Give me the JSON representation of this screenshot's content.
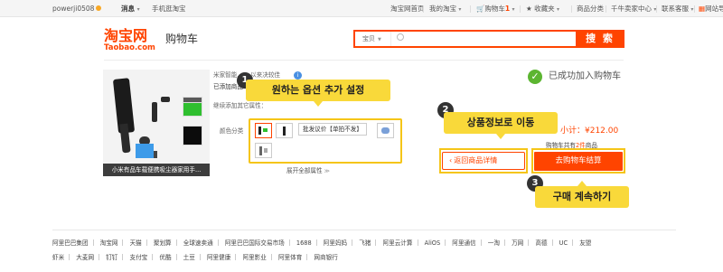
{
  "topbar": {
    "username": "powerji0508",
    "messages": "消息",
    "mobile_taobao": "手机逛淘宝",
    "home": "淘宝网首页",
    "my_taobao": "我的淘宝",
    "cart_label": "购物车",
    "cart_count": "1",
    "favorites": "收藏夹",
    "categories": "商品分类",
    "seller_center": "千牛卖家中心",
    "contact": "联系客服",
    "site_nav": "网站导航"
  },
  "header": {
    "logo_cn": "淘宝网",
    "logo_en": "Taobao.com",
    "cart_title": "购物车",
    "search_scope": "宝贝",
    "search_button": "搜 索",
    "search_value": ""
  },
  "product": {
    "caption": "小米有品车载便携吸尘器家用手...",
    "line1": "米家智能...   ...以来决较佳",
    "line2": "已添加商品...",
    "line3": "继续添加其它属性：",
    "color_label": "颜色分类",
    "option_text": "批发议价【单拍不发】",
    "expand": "展开全部属性",
    "expand_chev": "≫"
  },
  "result": {
    "added": "已成功加入购物车",
    "subtotal": "小计：¥212.00",
    "cart_info_prefix": "购物车共有",
    "cart_info_count": "2件",
    "cart_info_suffix": "商品",
    "back_button": "返回商品详情",
    "checkout_button": "去购物车结算"
  },
  "annotations": [
    {
      "num": "1",
      "text": "원하는 옵션 추가 설정"
    },
    {
      "num": "2",
      "text": "상품정보로 이동"
    },
    {
      "num": "3",
      "text": "구매 계속하기"
    }
  ],
  "footer": {
    "row1": [
      "阿里巴巴集团",
      "淘宝网",
      "天猫",
      "聚划算",
      "全球速卖通",
      "阿里巴巴国际交易市场",
      "1688",
      "阿里妈妈",
      "飞猪",
      "阿里云计算",
      "AliOS",
      "阿里通信",
      "一淘",
      "万网",
      "高德",
      "UC",
      "友盟"
    ],
    "row2": [
      "虾米",
      "大麦网",
      "钉钉",
      "支付宝",
      "优酷",
      "土豆",
      "阿里健康",
      "阿里影业",
      "阿里体育",
      "网商银行"
    ]
  },
  "colors": {
    "accent": "#ff4400",
    "highlight": "#f5c518",
    "callout": "#f9d93a",
    "success": "#5cb531"
  }
}
